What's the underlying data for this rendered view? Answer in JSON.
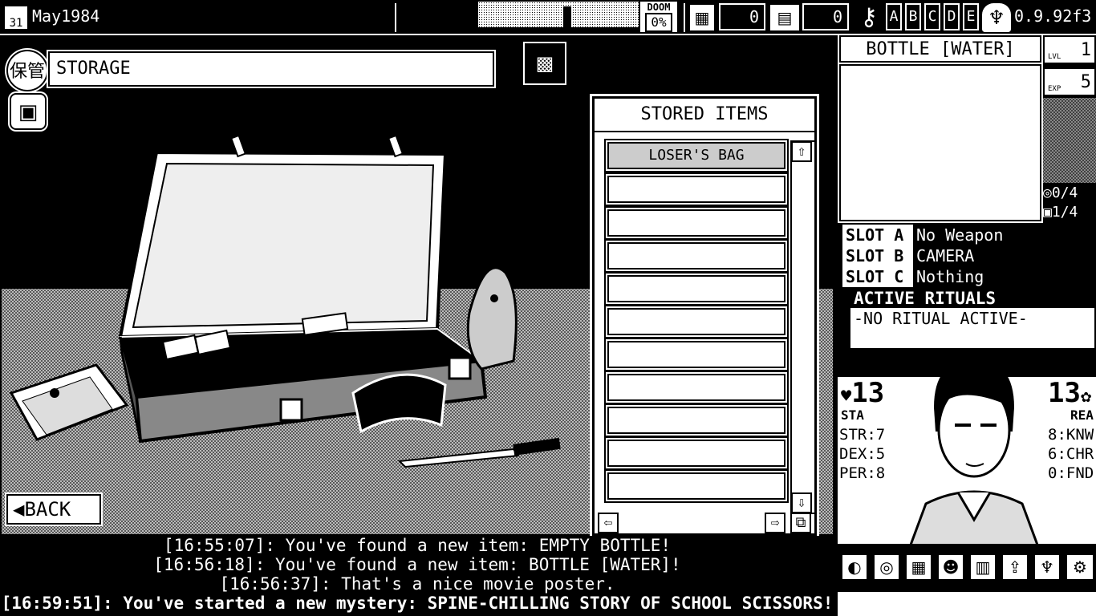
{
  "topbar": {
    "date_icon": "31",
    "date": "May1984",
    "doom_label": "DOOM",
    "doom_value": "0%",
    "counter_a": "0",
    "counter_b": "0",
    "letters": [
      "A",
      "B",
      "C",
      "D",
      "E"
    ],
    "version": "0.9.92f3"
  },
  "location": {
    "badge": "保管",
    "title": "STORAGE"
  },
  "back_label": "◀BACK",
  "stored": {
    "header": "STORED ITEMS",
    "items": [
      "LOSER'S BAG",
      "",
      "",
      "",
      "",
      "",
      "",
      "",
      "",
      "",
      ""
    ]
  },
  "log": [
    "[16:55:07]: You've found a new item: EMPTY BOTTLE!",
    "[16:56:18]: You've found a new item: BOTTLE [WATER]!",
    "[16:56:37]: That's a nice movie poster.",
    "[16:59:51]: You've started a new mystery: SPINE-CHILLING STORY OF SCHOOL SCISSORS!"
  ],
  "right": {
    "item_title": "BOTTLE [WATER]",
    "lvl_label": "LVL",
    "lvl_value": "1",
    "exp_label": "EXP",
    "exp_value": "5",
    "spiral_count": "0/4",
    "bag_count": "1/4",
    "slots": [
      {
        "label": "SLOT A",
        "value": "No Weapon"
      },
      {
        "label": "SLOT B",
        "value": "CAMERA"
      },
      {
        "label": "SLOT C",
        "value": "Nothing"
      }
    ],
    "rituals_header": "ACTIVE RITUALS",
    "rituals_value": "-NO RITUAL ACTIVE-",
    "sta_value": "13",
    "sta_label": "STA",
    "rea_value": "13",
    "rea_label": "REA",
    "stats_left": [
      "STR:7",
      "DEX:5",
      "PER:8"
    ],
    "stats_right": [
      "8:KNW",
      "6:CHR",
      "0:FND"
    ]
  },
  "toolbar_icons": [
    "mystery-icon",
    "spiral-icon",
    "journal-icon",
    "social-icon",
    "map-icon",
    "level-up-icon",
    "monster-icon",
    "settings-icon"
  ]
}
